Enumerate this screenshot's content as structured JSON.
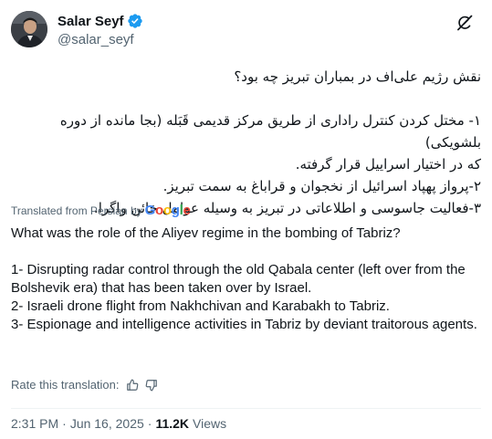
{
  "author": {
    "display_name": "Salar Seyf",
    "handle": "@salar_seyf"
  },
  "persian": {
    "line1": "نقش رژیم علی‌اف در بمباران تبریز چه بود؟",
    "line2": "۱- مختل کردن کنترل راداری از طریق مرکز قدیمی قَبَله (بجا مانده از دوره بلشویکی)",
    "line3": "که در اختیار اسراییل قرار گرفته.",
    "line4": "۲-پرواز پهپاد اسرائیل از نخجوان و قراباغ به سمت تبریز.",
    "line5": "۳-فعالیت جاسوسی و اطلاعاتی در تبریز به وسیله عوامل خائن واگرا."
  },
  "translation": {
    "label": "Translated from Persian by",
    "provider": "Google"
  },
  "english": {
    "question": "What was the role of the Aliyev regime in the bombing of Tabriz?",
    "point1": "1- Disrupting radar control through the old Qabala center (left over from the Bolshevik era) that has been taken over by Israel.",
    "point2": "2- Israeli drone flight from Nakhchivan and Karabakh to Tabriz.",
    "point3": "3- Espionage and intelligence activities in Tabriz by deviant traitorous agents."
  },
  "rate": {
    "label": "Rate this translation:"
  },
  "meta": {
    "time": "2:31 PM",
    "date": "Jun 16, 2025",
    "separator": "·",
    "views_count": "11.2K",
    "views_label": "Views"
  },
  "colors": {
    "verified": "#1d9bf0",
    "text": "#0f1419",
    "secondary": "#536471",
    "google_blue": "#4285f4",
    "google_red": "#ea4335",
    "google_yellow": "#fbbc05",
    "google_green": "#34a853"
  },
  "icons": {
    "verified": "verified-badge-icon",
    "grok": "grok-icon",
    "thumbs_up": "thumbs-up-icon",
    "thumbs_down": "thumbs-down-icon"
  }
}
